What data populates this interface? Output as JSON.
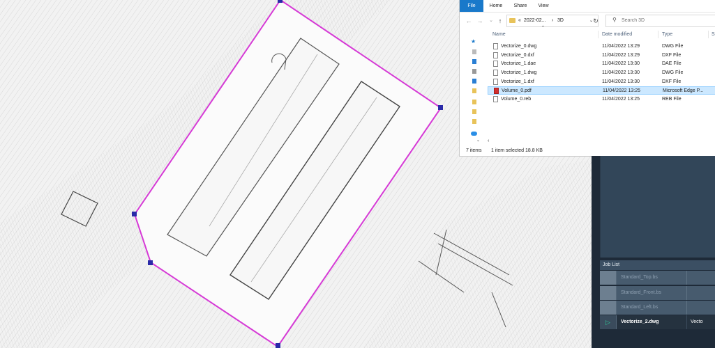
{
  "explorer": {
    "ribbon_tabs": [
      "File",
      "Home",
      "Share",
      "View"
    ],
    "breadcrumb": {
      "prefix": "«",
      "folder": "2022-02...",
      "sep": "›",
      "current": "3D"
    },
    "search_placeholder": "Search 3D",
    "columns": {
      "name": "Name",
      "date": "Date modified",
      "type": "Type",
      "size": "S"
    },
    "files": [
      {
        "name": "Vectorize_0.dwg",
        "date": "11/04/2022 13:29",
        "type": "DWG File",
        "icon": "file-icon"
      },
      {
        "name": "Vectorize_0.dxf",
        "date": "11/04/2022 13:29",
        "type": "DXF File",
        "icon": "file-icon"
      },
      {
        "name": "Vectorize_1.dae",
        "date": "11/04/2022 13:30",
        "type": "DAE File",
        "icon": "file-icon"
      },
      {
        "name": "Vectorize_1.dwg",
        "date": "11/04/2022 13:30",
        "type": "DWG File",
        "icon": "file-icon"
      },
      {
        "name": "Vectorize_1.dxf",
        "date": "11/04/2022 13:30",
        "type": "DXF File",
        "icon": "file-icon"
      },
      {
        "name": "Volume_0.pdf",
        "date": "11/04/2022 13:25",
        "type": "Microsoft Edge P...",
        "icon": "pdf-icon"
      },
      {
        "name": "Volume_0.reb",
        "date": "11/04/2022 13:25",
        "type": "REB File",
        "icon": "file-icon"
      }
    ],
    "status": {
      "count": "7 items",
      "selection": "1 item selected  18.8 KB"
    }
  },
  "job_list": {
    "title": "Job List",
    "jobs": [
      {
        "name": "Standard_Top.bs",
        "extra": ""
      },
      {
        "name": "Standard_Front.bs",
        "extra": ""
      },
      {
        "name": "Standard_Left.bs",
        "extra": ""
      },
      {
        "name": "Vectorize_2.dwg",
        "extra": "Vecto"
      }
    ]
  },
  "colors": {
    "boundary": "#d63ad6",
    "vertex": "#2a2aa8",
    "accent": "#1979ca",
    "selected_row": "#cce8ff"
  }
}
